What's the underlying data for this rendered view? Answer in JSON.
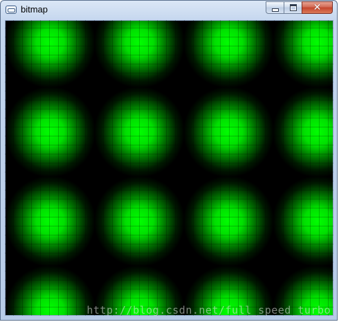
{
  "window": {
    "title": "bitmap",
    "icon": "app-window-icon"
  },
  "controls": {
    "minimize_icon": "minimize-icon",
    "maximize_icon": "maximize-icon",
    "close_glyph": "✕"
  },
  "canvas": {
    "pattern": "green radial tiles on black",
    "accent": "#00ff00"
  },
  "watermark": "http://blog.csdn.net/full_speed_turbo"
}
